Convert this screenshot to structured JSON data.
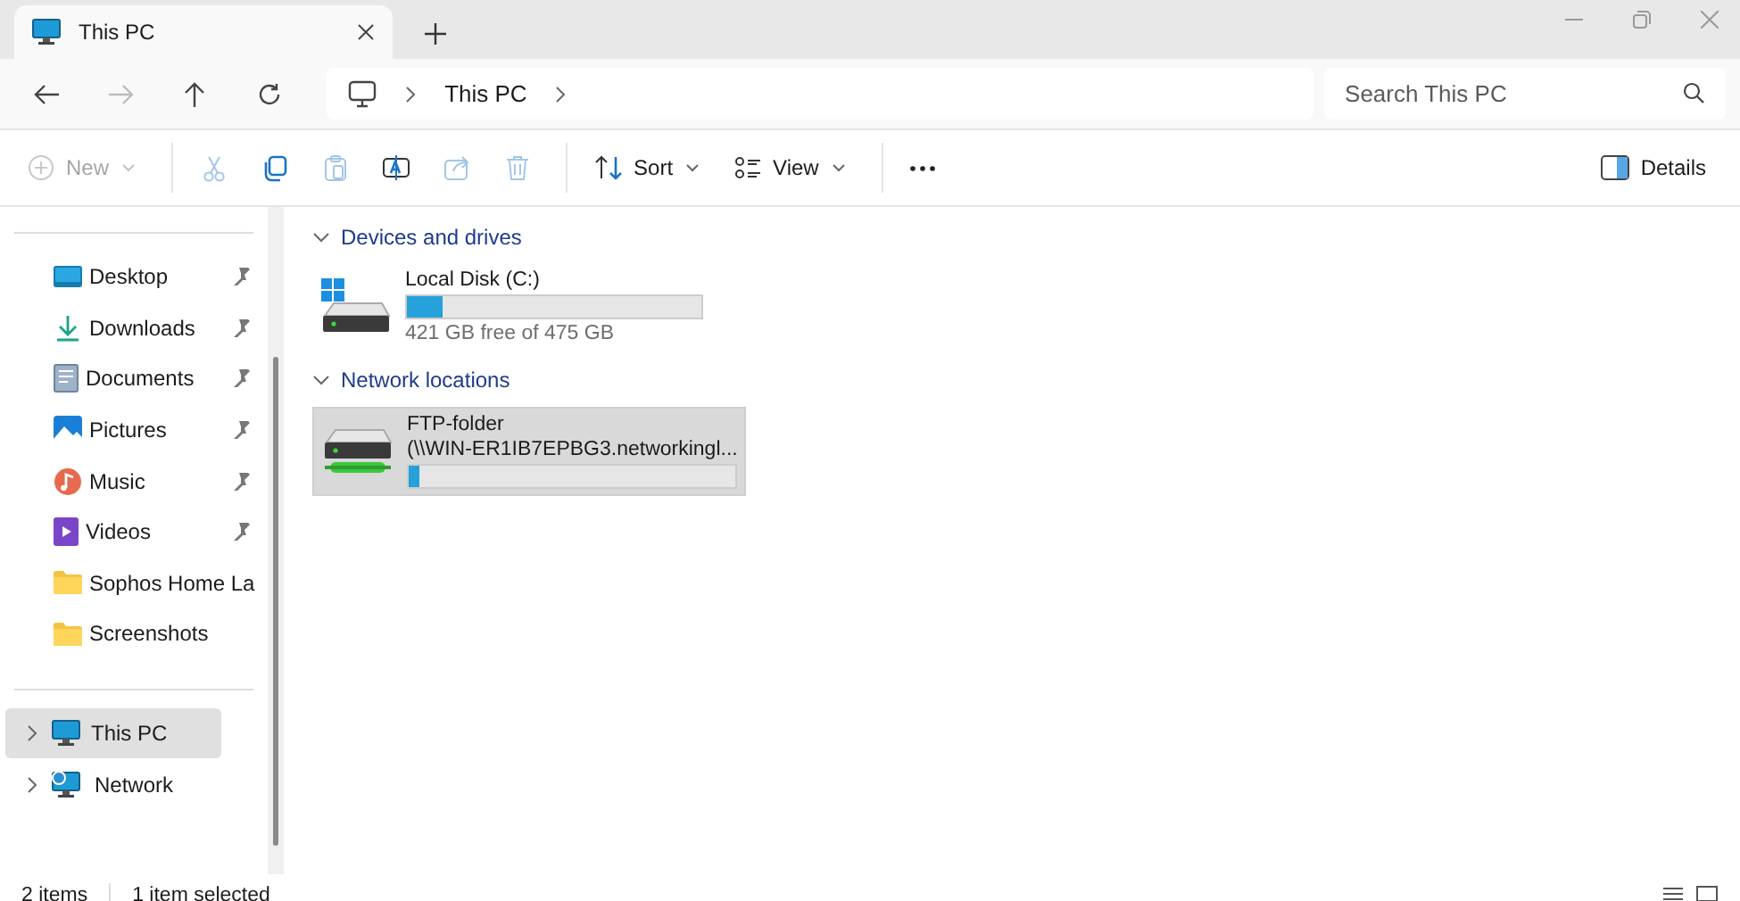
{
  "tab": {
    "title": "This PC",
    "selected": true
  },
  "address": {
    "crumbs": [
      "This PC"
    ]
  },
  "search": {
    "placeholder": "Search This PC"
  },
  "toolbar": [
    {
      "kind": "new",
      "label": "New",
      "disabled": true
    },
    {
      "kind": "cut",
      "disabled": true
    },
    {
      "kind": "copy",
      "disabled": false
    },
    {
      "kind": "paste",
      "disabled": true
    },
    {
      "kind": "rename",
      "disabled": false
    },
    {
      "kind": "share",
      "disabled": true
    },
    {
      "kind": "delete",
      "disabled": true
    },
    {
      "kind": "sort",
      "label": "Sort",
      "disabled": false
    },
    {
      "kind": "view",
      "label": "View",
      "disabled": false
    },
    {
      "kind": "more",
      "disabled": false
    }
  ],
  "details_button": {
    "label": "Details"
  },
  "sidebar": {
    "quick_access": [
      {
        "kind": "desktop",
        "label": "Desktop",
        "pinned": true
      },
      {
        "kind": "downloads",
        "label": "Downloads",
        "pinned": true
      },
      {
        "kind": "documents",
        "label": "Documents",
        "pinned": true
      },
      {
        "kind": "pictures",
        "label": "Pictures",
        "pinned": true
      },
      {
        "kind": "music",
        "label": "Music",
        "pinned": true
      },
      {
        "kind": "videos",
        "label": "Videos",
        "pinned": true
      },
      {
        "kind": "folder",
        "label": "Sophos Home La",
        "pinned": false
      },
      {
        "kind": "folder",
        "label": "Screenshots",
        "pinned": false
      }
    ],
    "tree": [
      {
        "kind": "pc",
        "label": "This PC",
        "selected": true,
        "expanded": false
      },
      {
        "kind": "network",
        "label": "Network",
        "selected": false,
        "expanded": false
      }
    ]
  },
  "sections": [
    {
      "title": "Devices and drives",
      "expanded": true,
      "items": [
        {
          "kind": "system",
          "name": "Local Disk (C:)",
          "detail": "421 GB free of 475 GB",
          "level": 0.12,
          "selected": false
        }
      ]
    },
    {
      "title": "Network locations",
      "expanded": true,
      "items": [
        {
          "kind": "network",
          "name": "FTP-folder",
          "detail": "(\\\\WIN-ER1IB7EPBG3.networkingl...",
          "level": 0.03,
          "selected": true
        }
      ]
    }
  ],
  "status_bar": {
    "count": "2 items",
    "selection": "1 item selected"
  }
}
